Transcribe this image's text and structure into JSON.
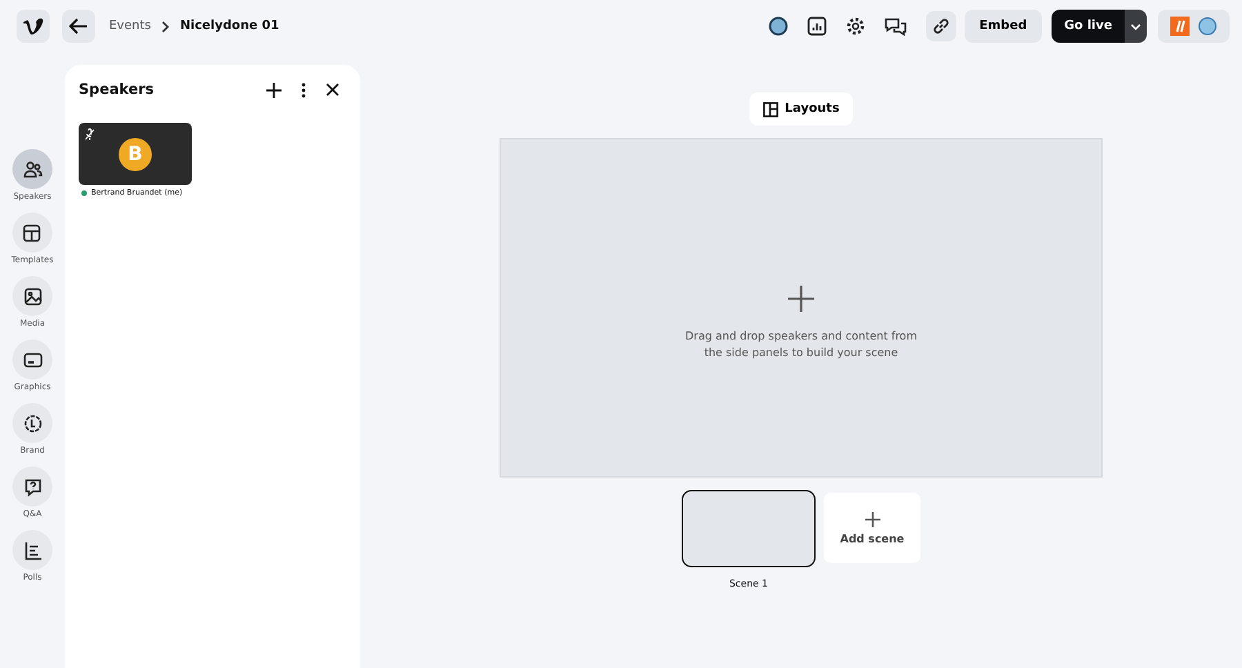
{
  "breadcrumb": {
    "parent": "Events",
    "current": "Nicelydone 01"
  },
  "toolbar": {
    "embed": "Embed",
    "go_live": "Go live"
  },
  "rail": [
    {
      "kind": "speakers",
      "label": "Speakers",
      "selected": true
    },
    {
      "kind": "templates",
      "label": "Templates",
      "selected": false
    },
    {
      "kind": "media",
      "label": "Media",
      "selected": false
    },
    {
      "kind": "graphics",
      "label": "Graphics",
      "selected": false
    },
    {
      "kind": "brand",
      "label": "Brand",
      "selected": false
    },
    {
      "kind": "qa",
      "label": "Q&A",
      "selected": false
    },
    {
      "kind": "polls",
      "label": "Polls",
      "selected": false
    }
  ],
  "panel": {
    "title": "Speakers",
    "speakers": [
      {
        "initial": "B",
        "name": "Bertrand Bruandet (me)",
        "muted": true
      }
    ]
  },
  "stage": {
    "layouts": "Layouts",
    "hint": "Drag and drop speakers and content from the side panels to build your scene"
  },
  "scenes": [
    {
      "label": "Scene 1",
      "selected": true
    }
  ],
  "add_scene": "Add scene"
}
